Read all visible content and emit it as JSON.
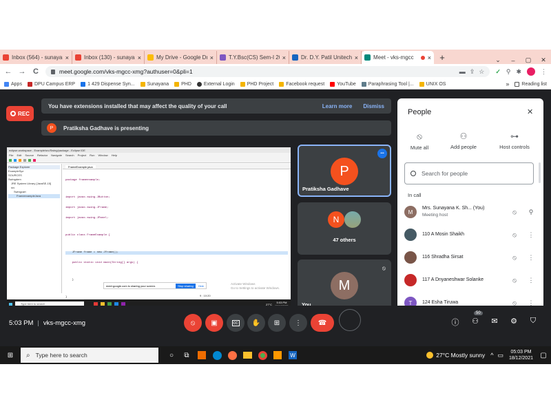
{
  "browser": {
    "tabs": [
      {
        "label": "Inbox (564) - sunayan",
        "favicon_color": "#ea4335",
        "active": false
      },
      {
        "label": "Inbox (130) - sunayan",
        "favicon_color": "#ea4335",
        "active": false
      },
      {
        "label": "My Drive - Google Dr",
        "favicon_color": "#fbbc04",
        "active": false
      },
      {
        "label": "T.Y.Bsc(CS) Sem-I 202",
        "favicon_color": "#7e57c2",
        "active": false
      },
      {
        "label": "Dr. D.Y. Patil Unitech",
        "favicon_color": "#1565c0",
        "active": false
      },
      {
        "label": "Meet - vks-mgcc",
        "favicon_color": "#00897b",
        "active": true
      }
    ],
    "new_tab_label": "+",
    "close_glyph": "×",
    "window_controls": [
      "⌄",
      "–",
      "▢",
      "✕"
    ],
    "nav": {
      "back": "←",
      "forward": "→",
      "reload": "C"
    },
    "url": "meet.google.com/vks-mgcc-xmg?authuser=0&pli=1",
    "toolbar_icons": [
      "cast-icon",
      "share-icon",
      "star-icon",
      "check-icon",
      "mic-icon",
      "extensions-icon",
      "profile-icon",
      "menu-icon"
    ],
    "bookmarks": [
      {
        "label": "Apps",
        "color": "#4285f4"
      },
      {
        "label": "DPU Campus ERP",
        "color": "#c62828"
      },
      {
        "label": "1 429 Dispense Syn...",
        "color": "#1a73e8"
      },
      {
        "label": "Sunayana",
        "color": "#f4b400"
      },
      {
        "label": "PHD",
        "color": "#f4b400"
      },
      {
        "label": "External Login",
        "color": "#333333"
      },
      {
        "label": "PHD Project",
        "color": "#f4b400"
      },
      {
        "label": "Facebook request",
        "color": "#f4b400"
      },
      {
        "label": "YouTube",
        "color": "#ff0000"
      },
      {
        "label": "Paraphrasing Tool |...",
        "color": "#607d8b"
      },
      {
        "label": "UNIX OS",
        "color": "#f4b400"
      }
    ],
    "bookmarks_more": "»",
    "reading_list": "Reading list"
  },
  "meet": {
    "rec_label": "REC",
    "extension_banner": {
      "text": "You have extensions installed that may affect the quality of your call",
      "learn_more": "Learn more",
      "dismiss": "Dismiss"
    },
    "presenting_banner": {
      "avatar": "P",
      "text": "Pratiksha Gadhave is presenting"
    },
    "tiles": [
      {
        "name": "Pratiksha Gadhave",
        "initial": "P",
        "color": "#f4511e"
      },
      {
        "name": "47 others",
        "initial": "N",
        "color": "#f4511e"
      },
      {
        "name": "You",
        "initial": "M",
        "color": "#8d6e63"
      }
    ],
    "tile_more_glyph": "•••",
    "people_panel": {
      "title": "People",
      "close": "✕",
      "actions": [
        "Mute all",
        "Add people",
        "Host controls"
      ],
      "search_placeholder": "Search for people",
      "section": "In call",
      "participants": [
        {
          "name": "Mrs. Sunayana K. Sh... (You)",
          "sub": "Meeting host",
          "initial": "M",
          "color": "#8d6e63"
        },
        {
          "name": "110 A Mosin Shaikh",
          "sub": "",
          "initial": "",
          "color": "#455a64"
        },
        {
          "name": "116 Shradha Sirsat",
          "sub": "",
          "initial": "",
          "color": "#795548"
        },
        {
          "name": "117 A Dnyaneshwar Solanke",
          "sub": "",
          "initial": "",
          "color": "#c62828"
        },
        {
          "name": "124 Esha Tiruwa",
          "sub": "",
          "initial": "T",
          "color": "#7e57c2"
        }
      ]
    },
    "time": "5:03 PM",
    "separator": "|",
    "meeting_code": "vks-mgcc-xmg",
    "participant_badge": "50"
  },
  "presentation": {
    "title": "eclipse-workspace - Example/src/Swing/package - Eclipse IDE",
    "menu": [
      "File",
      "Edit",
      "Source",
      "Refactor",
      "Navigate",
      "Search",
      "Project",
      "Run",
      "Window",
      "Help"
    ],
    "tree": [
      "Package Explorer",
      "ExampleSyz",
      "SOURCES",
      "Swingdem",
      "JRE System Library [JavaSE-15]",
      "src",
      "Swingcart",
      "FrameexampleJava"
    ],
    "editor_tab": "FrameExample.java",
    "code": [
      "package frameexample;",
      "",
      "import javax.swing.JButton;",
      "import javax.swing.JFrame;",
      "import javax.swing.JPanel;",
      "",
      "public class FrameExample {",
      "",
      "    JFrame frame = new JFrame();",
      "    public static void main(String[] args) {",
      "",
      "    }",
      "",
      "}"
    ],
    "share_notice": "meet.google.com is sharing your screen.",
    "stop_sharing": "Stop sharing",
    "hide": "Hide",
    "activate_1": "Activate Windows",
    "activate_2": "Go to Settings to activate Windows.",
    "status_pos": "9 : 10:20",
    "inner_search": "Type here to search",
    "inner_weather": "27°C",
    "inner_time": "5:03 PM",
    "inner_date": "12/18/2021"
  },
  "taskbar": {
    "search_placeholder": "Type here to search",
    "weather": "27°C  Mostly sunny",
    "time": "05:03 PM",
    "date": "18/12/2021"
  }
}
